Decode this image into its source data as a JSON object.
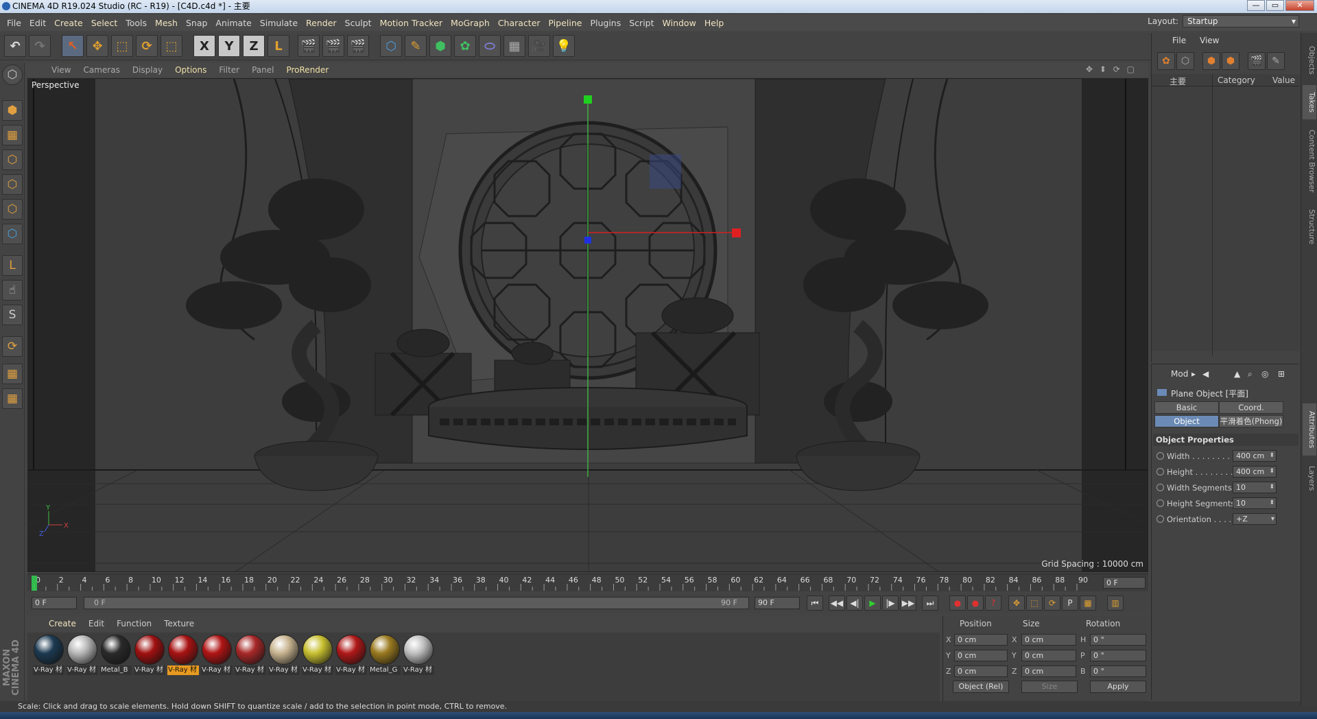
{
  "window": {
    "title": "CINEMA 4D R19.024 Studio (RC - R19) - [C4D.c4d *] - 主要",
    "controls": [
      "—",
      "▭",
      "✕"
    ]
  },
  "menu": [
    "File",
    "Edit",
    "Create",
    "Select",
    "Tools",
    "Mesh",
    "Snap",
    "Animate",
    "Simulate",
    "Render",
    "Sculpt",
    "Motion Tracker",
    "MoGraph",
    "Character",
    "Pipeline",
    "Plugins",
    "Script",
    "Window",
    "Help"
  ],
  "layout": {
    "label": "Layout:",
    "value": "Startup"
  },
  "toolbar": {
    "undo": "↶",
    "redo": "↷",
    "select": "↖",
    "move": "✥",
    "scale": "⬚",
    "rotate": "⟳",
    "last_tool": "⬚",
    "x_axis": "X",
    "y_axis": "Y",
    "z_axis": "Z",
    "coord": "L",
    "render_view": "🎬",
    "render_pv": "🎬",
    "render_settings": "🎬",
    "cube": "⬡",
    "pen": "✎",
    "subdivision": "⬢",
    "mograph": "✿",
    "deformer": "⬭",
    "floor": "▦",
    "camera": "🎥",
    "light": "💡"
  },
  "left_tools": [
    "⬡",
    "⬢",
    "▦",
    "⬡",
    "⬡",
    "⬡",
    "L",
    "☝",
    "S",
    "⟳",
    "▦",
    "▦"
  ],
  "viewport": {
    "menu": [
      "View",
      "Cameras",
      "Display",
      "Options",
      "Filter",
      "Panel",
      "ProRender"
    ],
    "nav_icons": "✥ ⬍ ⟳ ▢",
    "label": "Perspective",
    "grid_spacing": "Grid Spacing : 10000 cm",
    "axis_y": "Y",
    "axis_x": "X",
    "axis_z": "Z"
  },
  "timeline": {
    "ticks": [
      "0",
      "2",
      "4",
      "6",
      "8",
      "10",
      "12",
      "14",
      "16",
      "18",
      "20",
      "22",
      "24",
      "26",
      "28",
      "30",
      "32",
      "34",
      "36",
      "38",
      "40",
      "42",
      "44",
      "46",
      "48",
      "50",
      "52",
      "54",
      "56",
      "58",
      "60",
      "62",
      "64",
      "66",
      "68",
      "70",
      "72",
      "74",
      "76",
      "78",
      "80",
      "82",
      "84",
      "86",
      "88",
      "90"
    ],
    "current_frame": "0 F",
    "start": "0 F",
    "range_start": "0 F",
    "range_end": "90 F",
    "end": "90 F",
    "play_icons": [
      "⏮",
      "◀◀",
      "◀|",
      "▶",
      "|▶",
      "▶▶",
      "⏭"
    ],
    "key_icons": [
      "●",
      "●",
      "?",
      "✥",
      "⬚",
      "⟳",
      "P",
      "▦",
      "▥"
    ]
  },
  "materials": {
    "menu": [
      "Create",
      "Edit",
      "Function",
      "Texture"
    ],
    "items": [
      {
        "label": "V-Ray 材",
        "color": "#1c3a52"
      },
      {
        "label": "V-Ray 材",
        "color": "#b8b8b8"
      },
      {
        "label": "Metal_B",
        "color": "#2a2a2a"
      },
      {
        "label": "V-Ray 材",
        "color": "#a01010"
      },
      {
        "label": "V-Ray 材",
        "color": "#a81212",
        "selected": true
      },
      {
        "label": "V-Ray 材",
        "color": "#b01414"
      },
      {
        "label": "V-Ray 材",
        "color": "#a82828"
      },
      {
        "label": "V-Ray 材",
        "color": "#c8b490"
      },
      {
        "label": "V-Ray 材",
        "color": "#c8c030"
      },
      {
        "label": "V-Ray 材",
        "color": "#b01818"
      },
      {
        "label": "Metal_G",
        "color": "#9a7a20"
      },
      {
        "label": "V-Ray 材",
        "color": "#c0c0c0"
      }
    ]
  },
  "coords": {
    "headers": {
      "position": "Position",
      "size": "Size",
      "rotation": "Rotation"
    },
    "rows": [
      {
        "axis": "X",
        "pos": "0 cm",
        "saxis": "X",
        "size": "0 cm",
        "raxis": "H",
        "rot": "0 °"
      },
      {
        "axis": "Y",
        "pos": "0 cm",
        "saxis": "Y",
        "size": "0 cm",
        "raxis": "P",
        "rot": "0 °"
      },
      {
        "axis": "Z",
        "pos": "0 cm",
        "saxis": "Z",
        "size": "0 cm",
        "raxis": "B",
        "rot": "0 °"
      }
    ],
    "mode": "Object (Rel)",
    "size_mode": "Size",
    "apply": "Apply"
  },
  "status": "Scale: Click and drag to scale elements. Hold down SHIFT to quantize scale / add to the selection in point mode, CTRL to remove.",
  "maxon": [
    "MAXON",
    "CINEMA 4D"
  ],
  "objects": {
    "menu": [
      "File",
      "View"
    ],
    "tool_icons": [
      "✿",
      "⬡",
      "⬢",
      "⬢",
      "🎬",
      "✎"
    ],
    "col_name": "主要",
    "col_category": "Category",
    "col_value": "Value"
  },
  "attributes": {
    "menu": [
      "Mod",
      "▸",
      "◀",
      "▲",
      "⌕",
      "◎",
      "⊞"
    ],
    "title": "Plane Object [平面]",
    "tabs": [
      {
        "label": "Basic",
        "active": false
      },
      {
        "label": "Coord.",
        "active": false
      },
      {
        "label": "Object",
        "active": true
      },
      {
        "label": "平滑着色(Phong)",
        "active": false
      }
    ],
    "section": "Object Properties",
    "props": [
      {
        "name": "Width . . . . . . . . .",
        "value": "400 cm"
      },
      {
        "name": "Height . . . . . . . . .",
        "value": "400 cm"
      },
      {
        "name": "Width Segments",
        "value": "10"
      },
      {
        "name": "Height Segments",
        "value": "10"
      },
      {
        "name": "Orientation . . . . .",
        "value": "+Z"
      }
    ]
  },
  "side_tabs": [
    "Objects",
    "Takes",
    "Content Browser",
    "Structure",
    "Attributes",
    "Layers"
  ]
}
